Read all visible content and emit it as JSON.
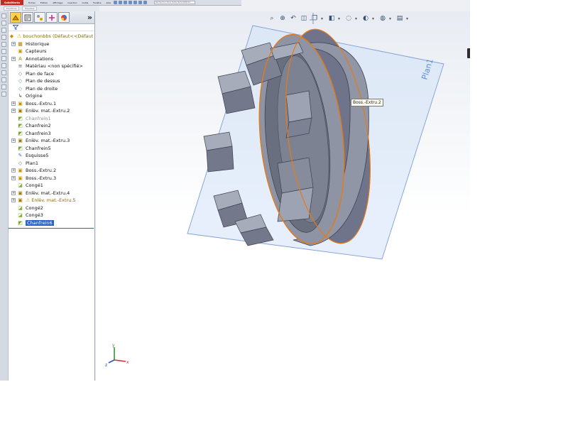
{
  "titlebar": {
    "logo": "SolidWorks",
    "menus": [
      "Fichier",
      "Edition",
      "Affichage",
      "Insertion",
      "Outils",
      "Fenêtre",
      "Aide"
    ],
    "search_placeholder": "Rechercher dans l'Aide de SolidWorks"
  },
  "command_tabs": [
    "Fonctions",
    "Esquisse"
  ],
  "feature_manager": {
    "tabs": [
      "featuremanager-icon",
      "propertymanager-icon",
      "configurationmanager-icon",
      "dimxpert-icon",
      "display-manager-icon"
    ],
    "expand_label": "»",
    "filter_icon": "filter-icon",
    "tree": [
      {
        "label": "bouchonbbs  (Défaut<<Défaut",
        "icon": "part-icon",
        "expand": false,
        "state": "warn",
        "root": true
      },
      {
        "label": "Historique",
        "icon": "history-icon",
        "expand": true
      },
      {
        "label": "Capteurs",
        "icon": "sensor-icon",
        "expand": false
      },
      {
        "label": "Annotations",
        "icon": "annotation-icon",
        "expand": true
      },
      {
        "label": "Matériau <non spécifié>",
        "icon": "material-icon",
        "expand": false
      },
      {
        "label": "Plan de face",
        "icon": "plane-icon",
        "expand": false
      },
      {
        "label": "Plan de dessus",
        "icon": "plane-icon",
        "expand": false
      },
      {
        "label": "Plan de droite",
        "icon": "plane-icon",
        "expand": false
      },
      {
        "label": "Origine",
        "icon": "origin-icon",
        "expand": false
      },
      {
        "label": "Boss.-Extru.1",
        "icon": "boss-extrude-icon",
        "expand": true
      },
      {
        "label": "Enlèv. mat.-Extru.2",
        "icon": "cut-extrude-icon",
        "expand": true
      },
      {
        "label": "Chanfrein1",
        "icon": "chamfer-icon",
        "expand": false,
        "state": "dim"
      },
      {
        "label": "Chanfrein2",
        "icon": "chamfer-icon",
        "expand": false
      },
      {
        "label": "Chanfrein3",
        "icon": "chamfer-icon",
        "expand": false
      },
      {
        "label": "Enlèv. mat.-Extru.3",
        "icon": "cut-extrude-icon",
        "expand": true
      },
      {
        "label": "Chanfrein5",
        "icon": "chamfer-icon",
        "expand": false
      },
      {
        "label": "Esquisse5",
        "icon": "sketch-icon",
        "expand": false
      },
      {
        "label": "Plan1",
        "icon": "plane-icon",
        "expand": false
      },
      {
        "label": "Boss.-Extru.2",
        "icon": "boss-extrude-icon",
        "expand": true
      },
      {
        "label": "Boss.-Extru.3",
        "icon": "boss-extrude-icon",
        "expand": true
      },
      {
        "label": "Congé1",
        "icon": "fillet-icon",
        "expand": false
      },
      {
        "label": "Enlèv. mat.-Extru.4",
        "icon": "cut-extrude-icon",
        "expand": true
      },
      {
        "label": "Enlèv. mat.-Extru.5",
        "icon": "cut-extrude-icon",
        "expand": true,
        "state": "warn"
      },
      {
        "label": "Congé2",
        "icon": "fillet-icon",
        "expand": false
      },
      {
        "label": "Congé3",
        "icon": "fillet-icon",
        "expand": false
      },
      {
        "label": "Chanfrein6",
        "icon": "chamfer-icon",
        "expand": false,
        "state": "selected"
      }
    ]
  },
  "viewport": {
    "plane_label": "Plan1",
    "callout": "Boss.-Extru.2",
    "heads_up_tools": [
      "zoom-to-fit-icon",
      "zoom-area-icon",
      "previous-view-icon",
      "section-view-icon",
      "view-orientation-icon",
      "display-style-icon",
      "hide-show-icon",
      "edit-appearance-icon",
      "apply-scene-icon",
      "view-settings-icon"
    ],
    "triad_axes": [
      "x",
      "y",
      "z"
    ],
    "colors": {
      "plane_fill": "#d2e2f7",
      "plane_edge": "#7e9fd6",
      "plane_label": "#5a8bd9",
      "body": "#7c8193",
      "body_light": "#a7acbb",
      "body_dark": "#4f5363",
      "selection_edge": "#e67a17"
    }
  }
}
